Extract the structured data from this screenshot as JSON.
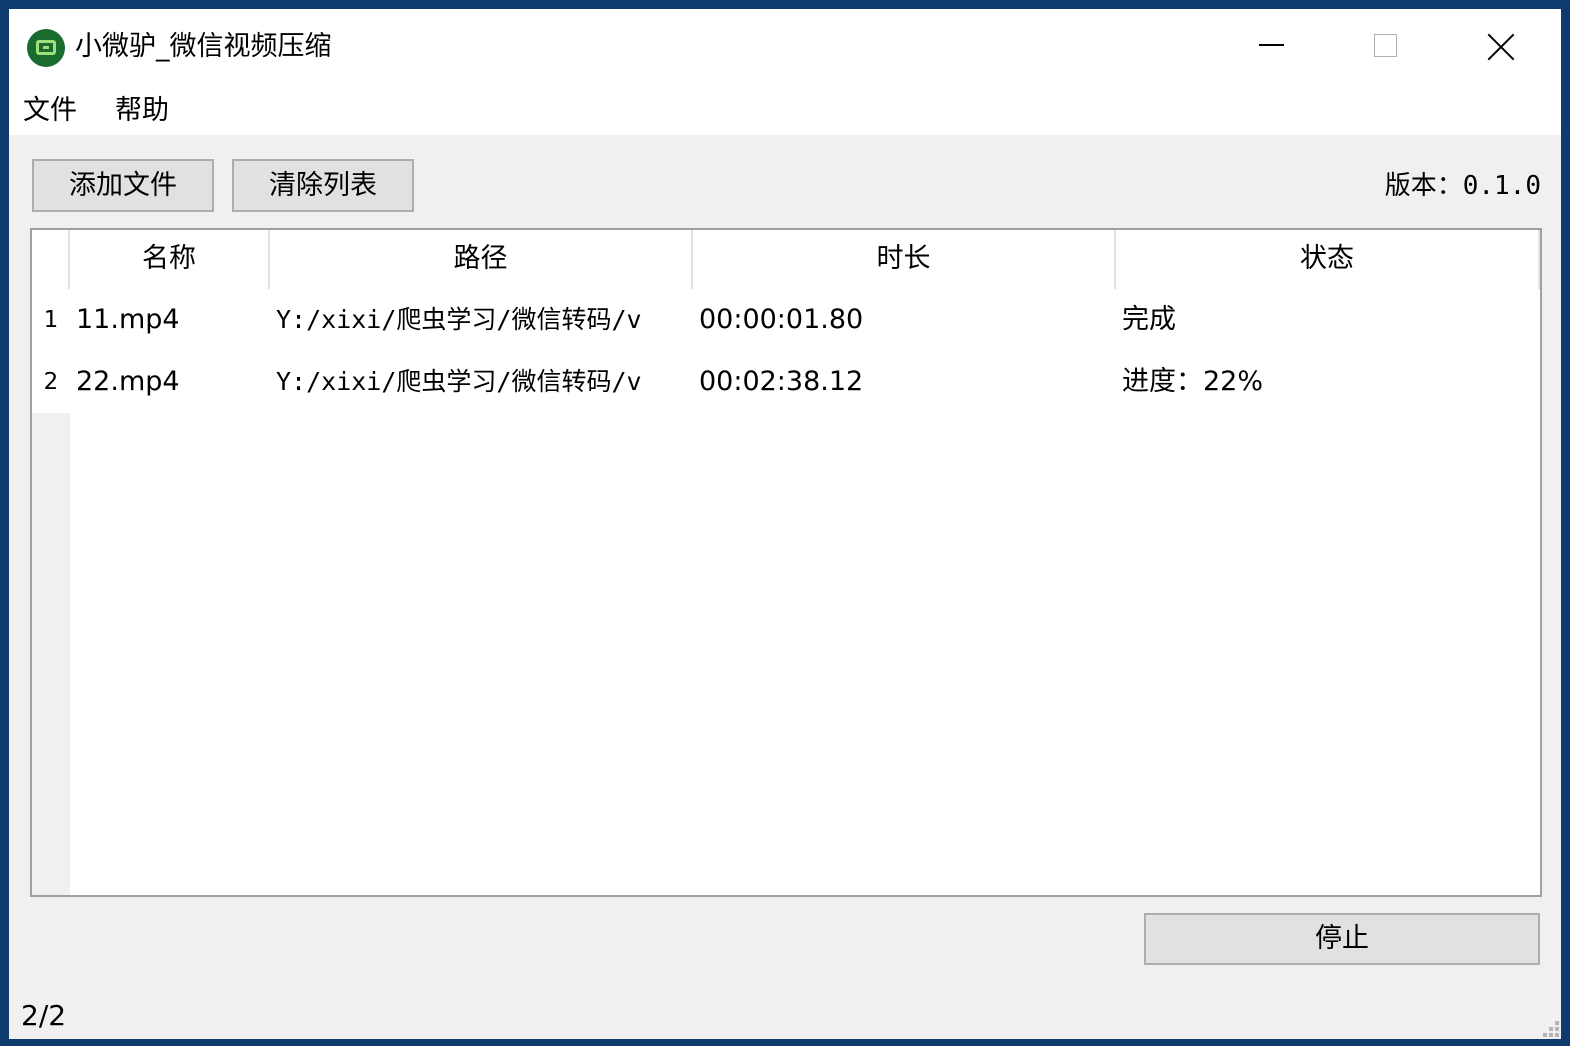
{
  "window": {
    "title": "小微驴_微信视频压缩",
    "icon": "app-logo-icon"
  },
  "menu": {
    "file": "文件",
    "help": "帮助"
  },
  "toolbar": {
    "add_files": "添加文件",
    "clear_list": "清除列表",
    "version_label": "版本：",
    "version_value": "0.1.0"
  },
  "table": {
    "columns": [
      "名称",
      "路径",
      "时长",
      "状态"
    ],
    "rows": [
      {
        "index": "1",
        "name": "11.mp4",
        "path": "Y:/xixi/爬虫学习/微信转码/v",
        "duration": "00:00:01.80",
        "status": "完成"
      },
      {
        "index": "2",
        "name": "22.mp4",
        "path": "Y:/xixi/爬虫学习/微信转码/v",
        "duration": "00:02:38.12",
        "status": "进度：22%"
      }
    ]
  },
  "actions": {
    "stop": "停止"
  },
  "status": {
    "count": "2/2"
  },
  "colors": {
    "desktop": "#0e3a6e",
    "window_bg": "#f0f0f0",
    "button_bg": "#e1e1e1",
    "icon_green": "#1a6b2e"
  }
}
